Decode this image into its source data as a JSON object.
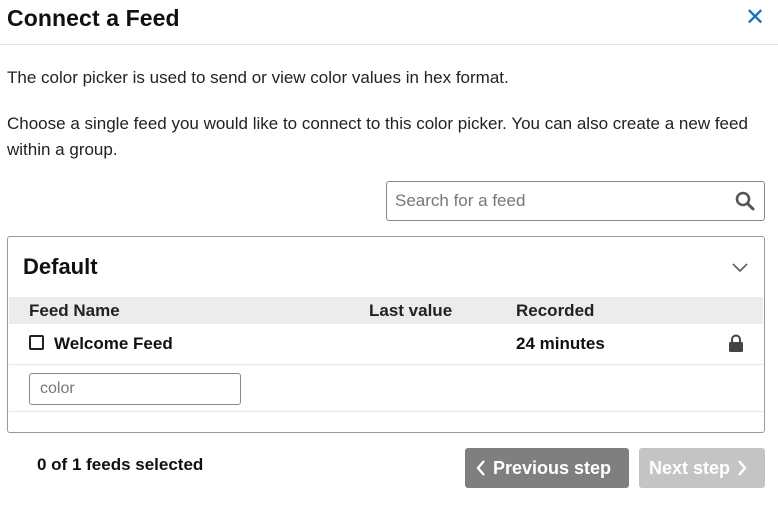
{
  "modal": {
    "title": "Connect a Feed",
    "close_label": "✕"
  },
  "intro_text": "The color picker is used to send or view color values in hex format.",
  "instructions_text": "Choose a single feed you would like to connect to this color picker. You can also create a new feed within a group.",
  "search": {
    "placeholder": "Search for a feed",
    "value": "",
    "icon": "search-icon"
  },
  "group": {
    "name": "Default",
    "collapse_icon": "chevron-down-icon",
    "columns": [
      "Feed Name",
      "Last value",
      "Recorded"
    ],
    "feeds": [
      {
        "name": "Welcome Feed",
        "last_value": "",
        "recorded": "24 minutes",
        "checked": false,
        "lock_icon": "lock-icon"
      }
    ],
    "new_feed_input": {
      "value": "",
      "placeholder": "color"
    }
  },
  "footer": {
    "selected_count": "0 of 1 feeds selected",
    "previous_label": "Previous step",
    "next_label": "Next step"
  },
  "colors": {
    "close": "#1a6fc2",
    "previous_button": "#7f7f7f",
    "next_button_disabled": "#c4c4c4",
    "table_header": "#ececec"
  }
}
